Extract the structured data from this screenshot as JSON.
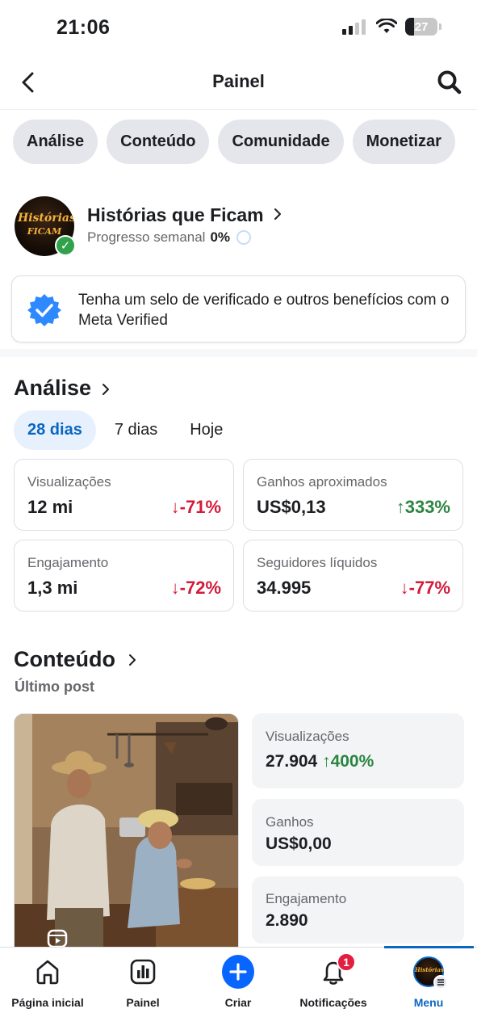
{
  "status_bar": {
    "time": "21:06",
    "battery": "27",
    "battery_level": 0.27
  },
  "header": {
    "title": "Painel"
  },
  "tabs": [
    {
      "label": "Análise"
    },
    {
      "label": "Conteúdo"
    },
    {
      "label": "Comunidade"
    },
    {
      "label": "Monetizar"
    }
  ],
  "page": {
    "name": "Histórias que Ficam",
    "avatar_text_line1": "Histórias",
    "avatar_text_line2": "FICAM",
    "progress_label": "Progresso semanal",
    "progress_value": "0%"
  },
  "banner": {
    "text": "Tenha um selo de verificado e outros benefícios com o Meta Verified"
  },
  "analysis": {
    "title": "Análise",
    "ranges": [
      {
        "label": "28 dias",
        "active": true
      },
      {
        "label": "7 dias",
        "active": false
      },
      {
        "label": "Hoje",
        "active": false
      }
    ],
    "metrics": [
      {
        "label": "Visualizações",
        "value": "12 mi",
        "change": "-71%",
        "direction": "down"
      },
      {
        "label": "Ganhos aproximados",
        "value": "US$0,13",
        "change": "333%",
        "direction": "up"
      },
      {
        "label": "Engajamento",
        "value": "1,3 mi",
        "change": "-72%",
        "direction": "down"
      },
      {
        "label": "Seguidores líquidos",
        "value": "34.995",
        "change": "-77%",
        "direction": "down"
      }
    ]
  },
  "content": {
    "title": "Conteúdo",
    "subtitle": "Último post",
    "stats": [
      {
        "label": "Visualizações",
        "value": "27.904",
        "change": "400%",
        "direction": "up"
      },
      {
        "label": "Ganhos",
        "value": "US$0,00"
      },
      {
        "label": "Engajamento",
        "value": "2.890"
      }
    ]
  },
  "bottom_nav": [
    {
      "label": "Página inicial",
      "icon": "home-icon"
    },
    {
      "label": "Painel",
      "icon": "dashboard-icon"
    },
    {
      "label": "Criar",
      "icon": "plus-icon"
    },
    {
      "label": "Notificações",
      "icon": "bell-icon",
      "badge": "1"
    },
    {
      "label": "Menu",
      "icon": "profile-avatar",
      "active": true
    }
  ],
  "colors": {
    "accent": "#0a66c2",
    "negative": "#d31b3a",
    "positive": "#2a8540",
    "create": "#0866ff"
  }
}
